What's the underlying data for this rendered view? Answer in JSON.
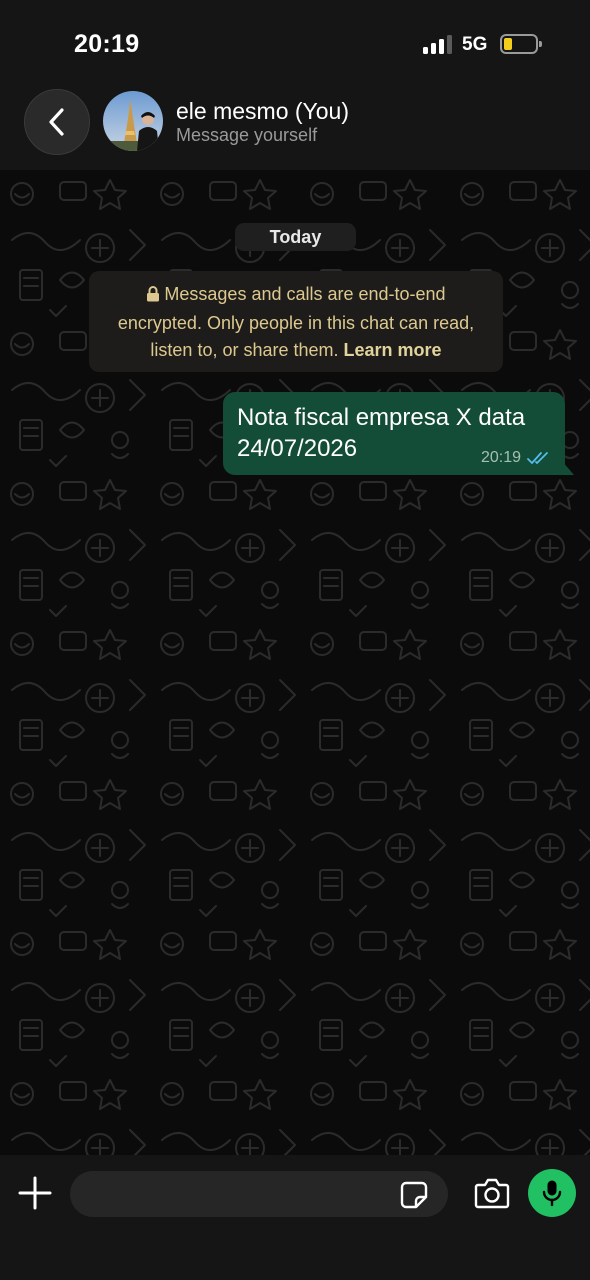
{
  "status_bar": {
    "time": "20:19",
    "network": "5G",
    "battery_level": 0.25,
    "battery_color": "#f2cf1b",
    "signal_bars_active": 3
  },
  "header": {
    "back_icon": "chevron-left-icon",
    "contact_name": "ele mesmo (You)",
    "contact_subtitle": "Message yourself",
    "avatar": "profile-photo"
  },
  "chat": {
    "date_chip": "Today",
    "e2e_notice": {
      "lock_icon": "lock-icon",
      "text": "Messages and calls are end-to-end encrypted. Only people in this chat can read, listen to, or share them. ",
      "link": "Learn more",
      "text_color": "#ddc98f"
    },
    "messages": [
      {
        "text": "Nota fiscal empresa X data 24/07/2026",
        "time": "20:19",
        "status": "read",
        "status_icon": "double-check-icon",
        "bubble_color": "#144d37"
      }
    ]
  },
  "composer": {
    "plus_icon": "plus-icon",
    "input_value": "",
    "sticker_icon": "sticker-icon",
    "camera_icon": "camera-icon",
    "mic_icon": "microphone-icon",
    "mic_color": "#21c063"
  }
}
